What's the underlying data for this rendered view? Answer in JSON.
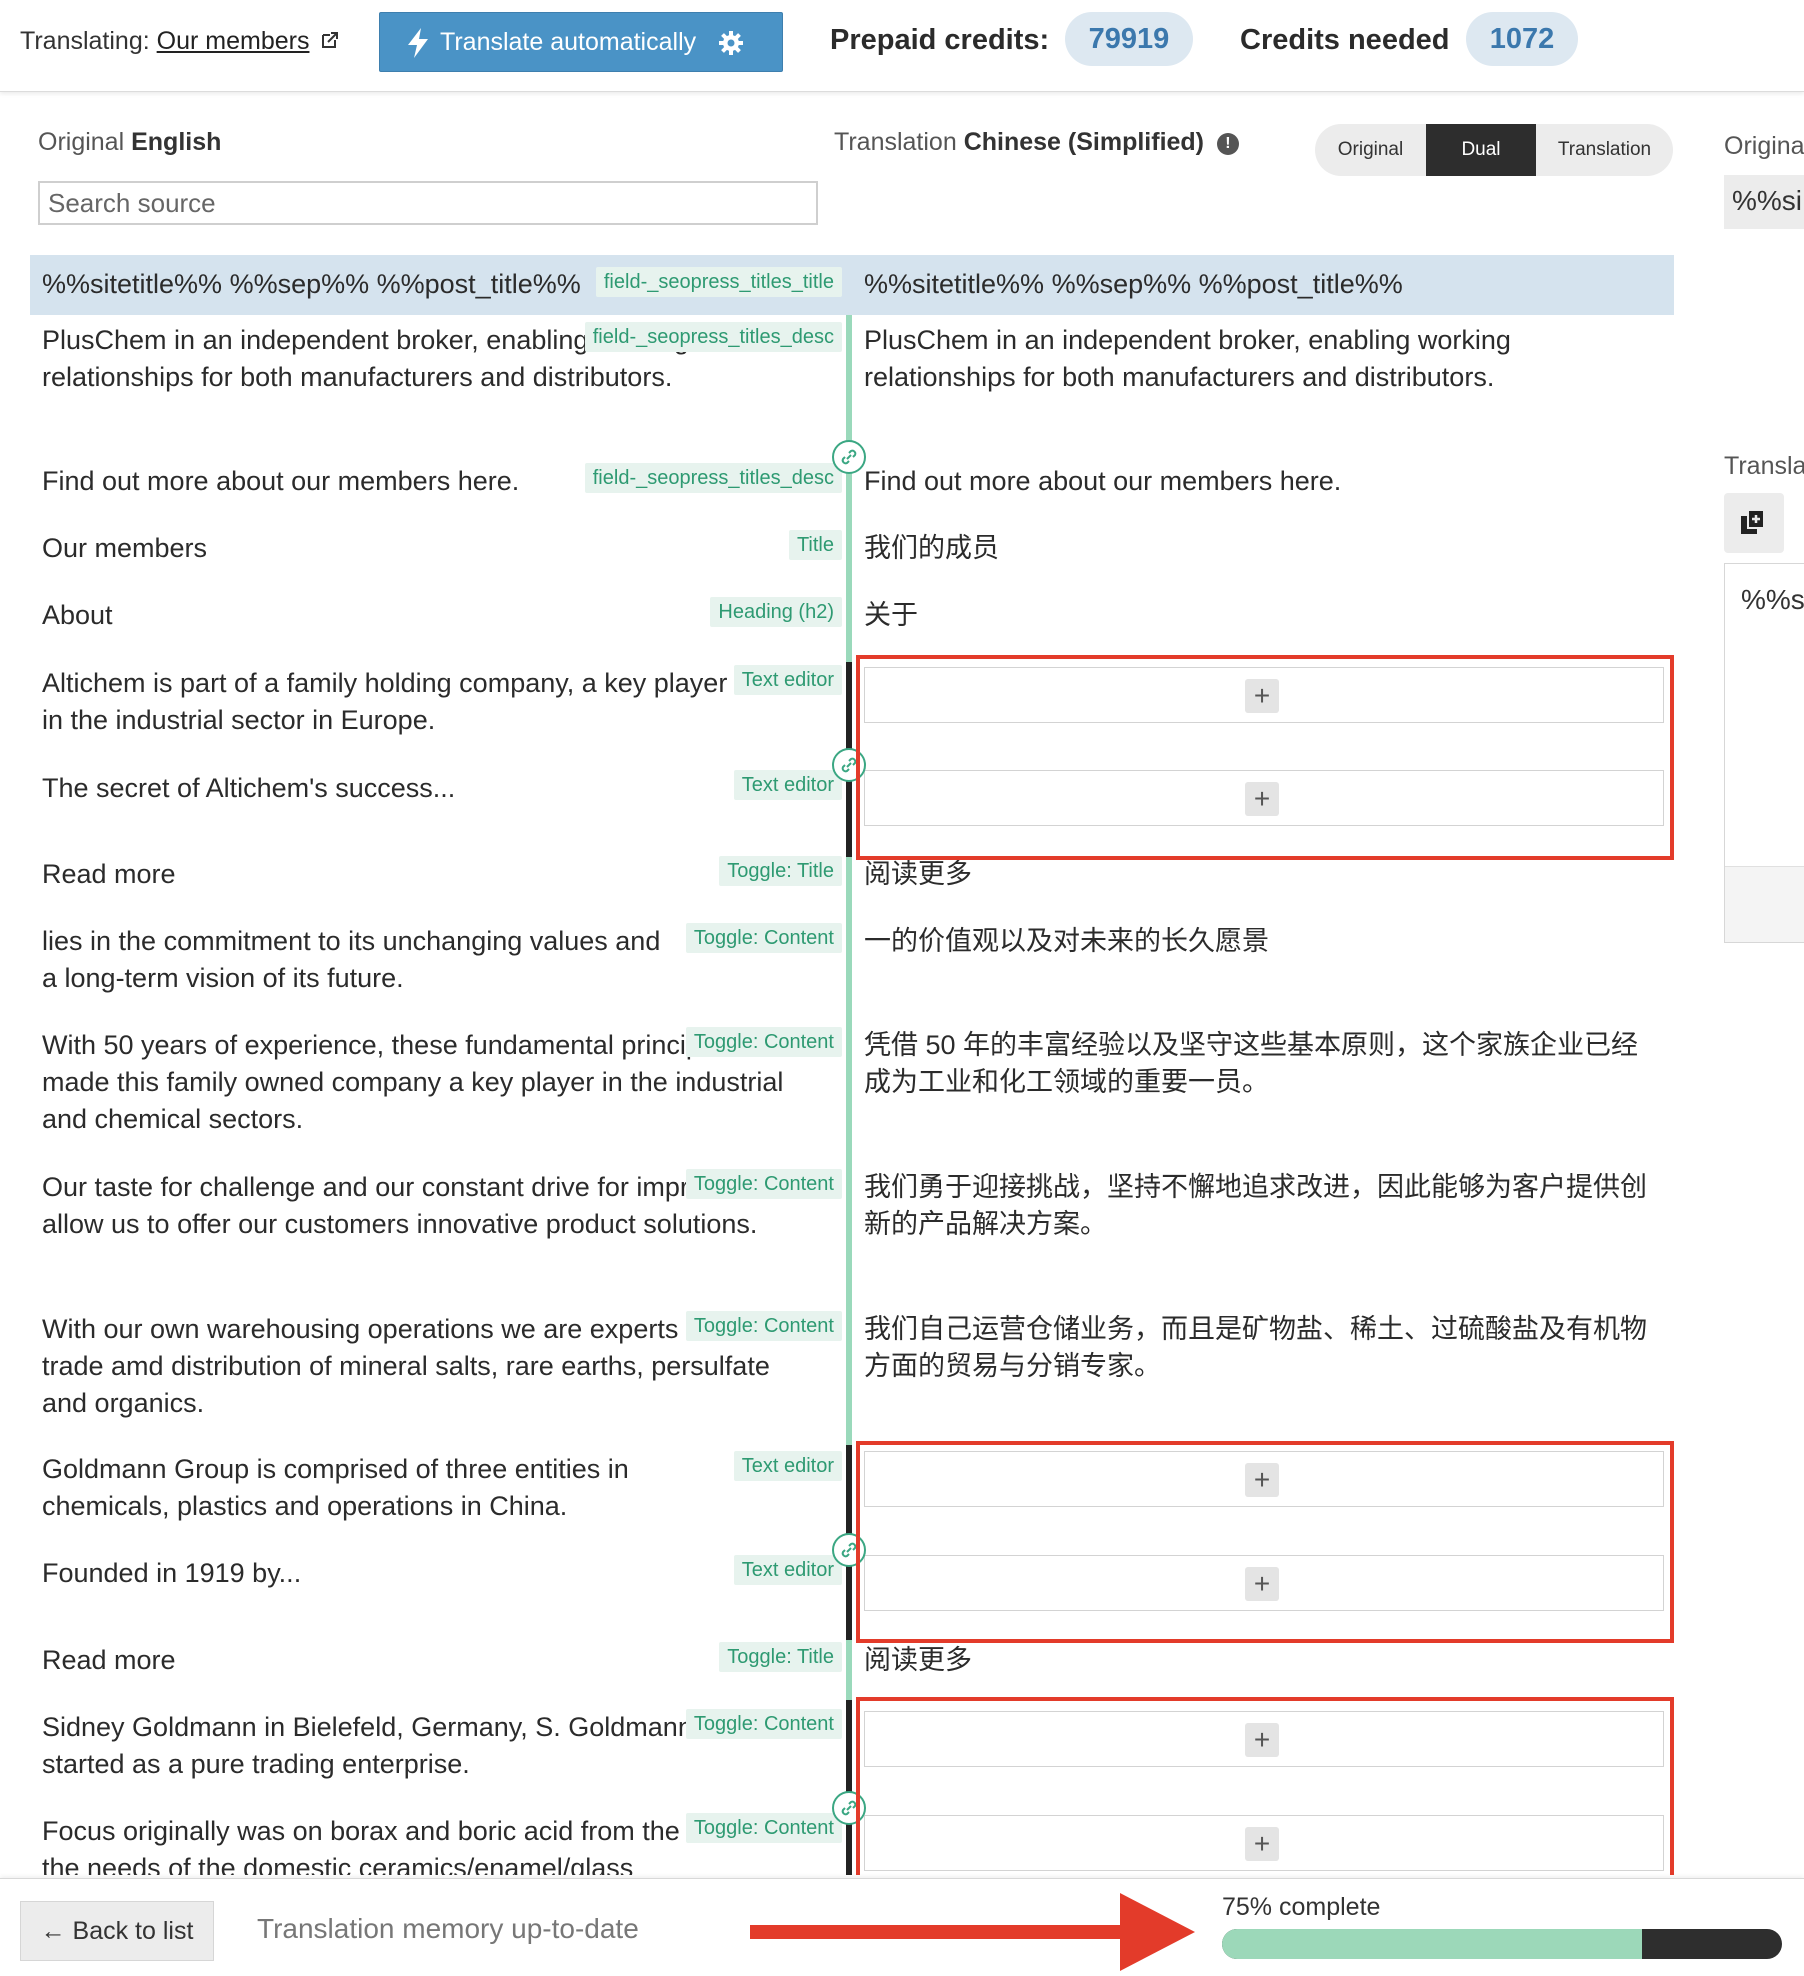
{
  "header": {
    "translating_label": "Translating:",
    "page_link": "Our members",
    "auto_button_label": "Translate automatically",
    "prepaid_label": "Prepaid credits:",
    "prepaid_value": "79919",
    "needed_label": "Credits needed",
    "needed_value": "1072"
  },
  "columns": {
    "original_label": "Original",
    "original_lang": "English",
    "translation_label": "Translation",
    "translation_lang": "Chinese (Simplified)",
    "search_placeholder": "Search source",
    "view_options": [
      "Original",
      "Dual",
      "Translation"
    ],
    "view_selected": "Dual"
  },
  "rows": [
    {
      "source": "%%sitetitle%% %%sep%% %%post_title%%",
      "tag": "field-_seopress_titles_title",
      "translation": "%%sitetitle%% %%sep%% %%post_title%%"
    },
    {
      "source": "PlusChem in an independent broker, enabling working relationships for both manufacturers and distributors.",
      "tag": "field-_seopress_titles_desc",
      "translation": "PlusChem in an independent broker, enabling working relationships for both manufacturers and distributors."
    },
    {
      "source": "Find out more about our members here.",
      "tag": "field-_seopress_titles_desc",
      "translation": "Find out more about our members here."
    },
    {
      "source": "Our members",
      "tag": "Title",
      "translation": "我们的成员"
    },
    {
      "source": "About",
      "tag": "Heading (h2)",
      "translation": "关于"
    },
    {
      "source": "Altichem is part of a family holding company, a key player in the industrial sector in Europe.",
      "tag": "Text editor",
      "translation": ""
    },
    {
      "source": "The secret of Altichem's success...",
      "tag": "Text editor",
      "translation": ""
    },
    {
      "source": "Read more",
      "tag": "Toggle: Title",
      "translation": "阅读更多"
    },
    {
      "source": "lies in the commitment to its unchanging values and a long-term vision of its future.",
      "tag": "Toggle: Content",
      "translation": "一的价值观以及对未来的长久愿景"
    },
    {
      "source": "With 50 years of experience, these fundamental principles have made this family owned company a key player in the industrial and chemical sectors.",
      "tag": "Toggle: Content",
      "translation": "凭借 50 年的丰富经验以及坚守这些基本原则，这个家族企业已经成为工业和化工领域的重要一员。"
    },
    {
      "source": "Our taste for challenge and our constant drive for improvement allow us to offer our customers innovative product solutions.",
      "tag": "Toggle: Content",
      "translation": "我们勇于迎接挑战，坚持不懈地追求改进，因此能够为客户提供创新的产品解决方案。"
    },
    {
      "source": "With our own warehousing operations we are experts in the trade amd distribution of mineral salts, rare earths, persulfate and organics.",
      "tag": "Toggle: Content",
      "translation": "我们自己运营仓储业务，而且是矿物盐、稀土、过硫酸盐及有机物方面的贸易与分销专家。"
    },
    {
      "source": "Goldmann Group is comprised of three entities in chemicals, plastics and operations in China.",
      "tag": "Text editor",
      "translation": ""
    },
    {
      "source": "Founded in 1919 by...",
      "tag": "Text editor",
      "translation": ""
    },
    {
      "source": "Read more",
      "tag": "Toggle: Title",
      "translation": "阅读更多"
    },
    {
      "source": "Sidney Goldmann in Bielefeld, Germany, S. Goldmann started as a pure trading enterprise.",
      "tag": "Toggle: Content",
      "translation": ""
    },
    {
      "source": "Focus originally was on borax and boric acid from the US to suit the needs of the domestic ceramics/enamel/glass",
      "tag": "Toggle: Content",
      "translation": ""
    }
  ],
  "add_button_label": "+",
  "side_panel": {
    "original_label": "Origina",
    "original_value": "%%si",
    "translation_label": "Transla",
    "editor_value": "%%s"
  },
  "footer": {
    "back_label": "← Back to list",
    "memory_status": "Translation memory up-to-date",
    "progress_label": "75% complete",
    "progress_value": 75
  },
  "colors": {
    "accent_blue": "#4a93c6",
    "tag_green": "#2e9a72",
    "progress_green": "#9cd8b9",
    "annotation_red": "#e33b2a"
  }
}
